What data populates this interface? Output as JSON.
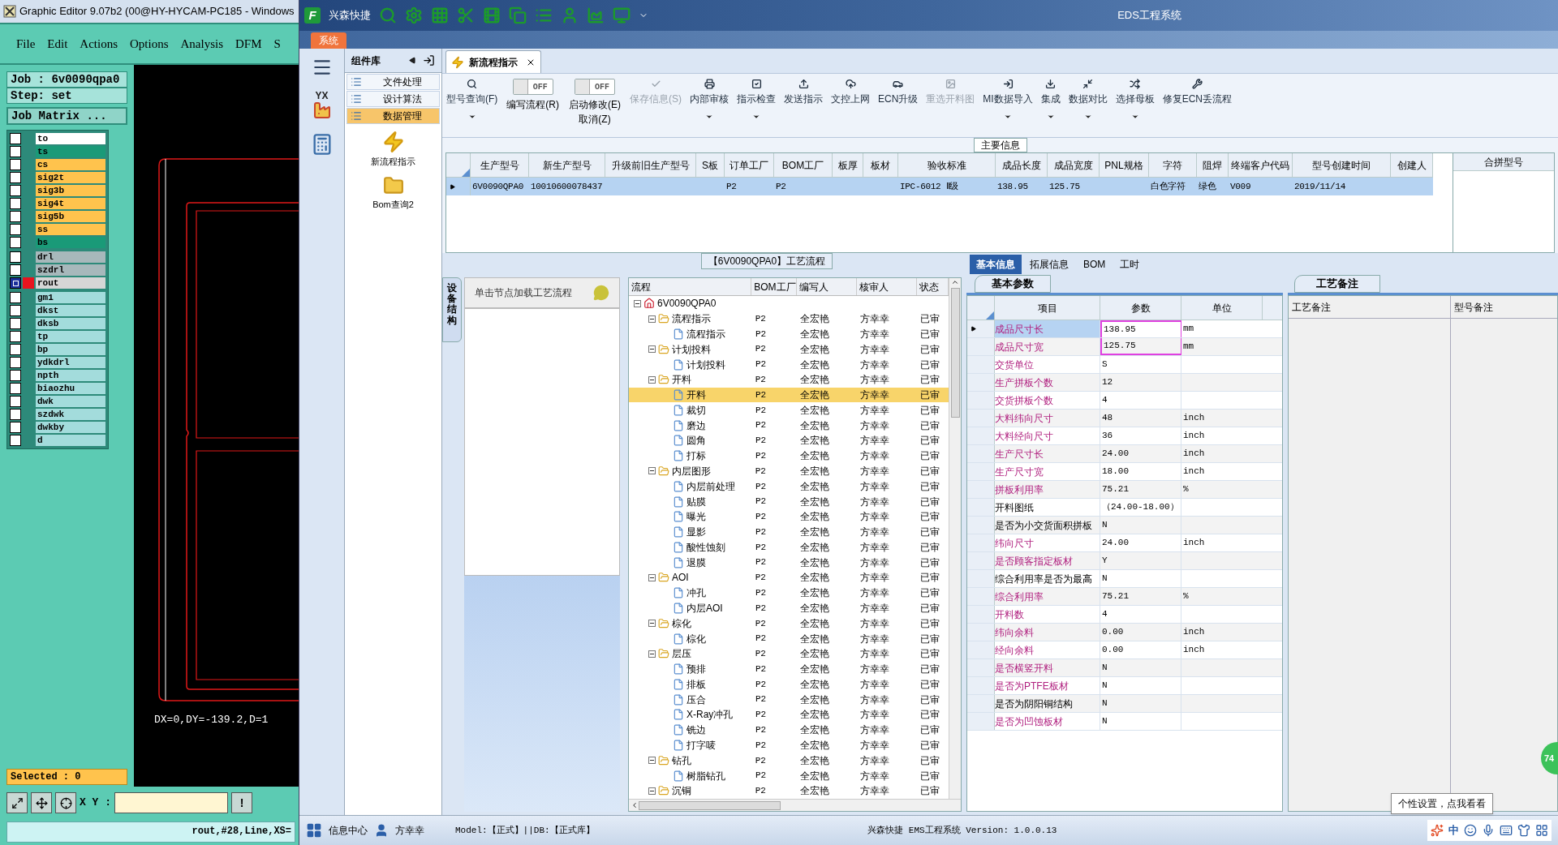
{
  "editor_window": {
    "title": "Graphic Editor 9.07b2 (00@HY-HYCAM-PC185 - Windows",
    "menu": [
      "File",
      "Edit",
      "Actions",
      "Options",
      "Analysis",
      "DFM",
      "S"
    ],
    "job": "Job : 6v0090qpa0",
    "step": "Step: set",
    "job_matrix": "Job Matrix ...",
    "layer_groups": [
      {
        "layers": [
          {
            "name": "to",
            "color": "#ffffff",
            "selected": false
          },
          {
            "name": "ts",
            "color": "#1a9a78",
            "selected": false
          },
          {
            "name": "cs",
            "color": "#ffc34d",
            "selected": false
          },
          {
            "name": "sig2t",
            "color": "#ffc34d",
            "selected": false
          },
          {
            "name": "sig3b",
            "color": "#ffc34d",
            "selected": false
          },
          {
            "name": "sig4t",
            "color": "#ffc34d",
            "selected": false
          },
          {
            "name": "sig5b",
            "color": "#ffc34d",
            "selected": false
          },
          {
            "name": "ss",
            "color": "#ffc34d",
            "selected": false
          },
          {
            "name": "bs",
            "color": "#1a9a78",
            "selected": false
          }
        ]
      },
      {
        "layers": [
          {
            "name": "drl",
            "color": "#a7b8bb",
            "selected": false
          },
          {
            "name": "szdrl",
            "color": "#a7b8bb",
            "selected": false
          },
          {
            "name": "rout",
            "color": "#d6d6d6",
            "selected": true
          }
        ]
      },
      {
        "layers": [
          {
            "name": "gm1",
            "color": "#a3dcdc",
            "selected": false
          },
          {
            "name": "dkst",
            "color": "#a3dcdc",
            "selected": false
          },
          {
            "name": "dksb",
            "color": "#a3dcdc",
            "selected": false
          },
          {
            "name": "tp",
            "color": "#a3dcdc",
            "selected": false
          },
          {
            "name": "bp",
            "color": "#a3dcdc",
            "selected": false
          },
          {
            "name": "ydkdrl",
            "color": "#a3dcdc",
            "selected": false
          },
          {
            "name": "npth",
            "color": "#a3dcdc",
            "selected": false
          },
          {
            "name": "biaozhu",
            "color": "#a3dcdc",
            "selected": false
          },
          {
            "name": "dwk",
            "color": "#a3dcdc",
            "selected": false
          },
          {
            "name": "szdwk",
            "color": "#a3dcdc",
            "selected": false
          },
          {
            "name": "dwkby",
            "color": "#a3dcdc",
            "selected": false
          },
          {
            "name": "d",
            "color": "#a3dcdc",
            "selected": false
          }
        ]
      }
    ],
    "readout": "DX=0,DY=-139.2,D=1",
    "selected_count": "Selected : 0",
    "xy_label": "X Y :",
    "warn_button": "!",
    "status": "rout,#28,Line,XS="
  },
  "app_window": {
    "logo": "F",
    "app_name": "兴森快捷",
    "title": "EDS工程系统",
    "system_tab": "系统",
    "nav_badge": "YX",
    "component_panel": {
      "title": "组件库",
      "items": [
        {
          "label": "文件处理",
          "selected": false
        },
        {
          "label": "设计算法",
          "selected": false
        },
        {
          "label": "数据管理",
          "selected": true
        }
      ],
      "launchers": [
        "新流程指示",
        "Bom查询2"
      ]
    },
    "doc_tab": "新流程指示",
    "toolbar": [
      {
        "kind": "button",
        "label": "型号查询(F)",
        "disabled": false,
        "dropdown": true
      },
      {
        "kind": "toggle",
        "state_text": "OFF",
        "on": false,
        "label": "编写流程(R)"
      },
      {
        "kind": "toggle",
        "state_text": "OFF",
        "on": false,
        "label": "启动修改(E)",
        "label2": "取消(Z)"
      },
      {
        "kind": "button",
        "label": "保存信息(S)",
        "disabled": true,
        "dropdown": false
      },
      {
        "kind": "button",
        "label": "内部审核",
        "disabled": false,
        "dropdown": true
      },
      {
        "kind": "button",
        "label": "指示检查",
        "disabled": false,
        "dropdown": true
      },
      {
        "kind": "button",
        "label": "发送指示",
        "disabled": false,
        "dropdown": false
      },
      {
        "kind": "button",
        "label": "文控上网",
        "disabled": false,
        "dropdown": false
      },
      {
        "kind": "button",
        "label": "ECN升级",
        "disabled": false,
        "dropdown": false
      },
      {
        "kind": "button",
        "label": "重选开料图",
        "disabled": true,
        "dropdown": false
      },
      {
        "kind": "button",
        "label": "MI数据导入",
        "disabled": false,
        "dropdown": true
      },
      {
        "kind": "button",
        "label": "集成",
        "disabled": false,
        "dropdown": true
      },
      {
        "kind": "button",
        "label": "数据对比",
        "disabled": false,
        "dropdown": true
      },
      {
        "kind": "button",
        "label": "选择母板",
        "disabled": false,
        "dropdown": true
      },
      {
        "kind": "button",
        "label": "修复ECN丢流程",
        "disabled": false,
        "dropdown": false
      }
    ],
    "main_info": {
      "title": "主要信息",
      "columns": [
        "生产型号",
        "新生产型号",
        "升级前旧生产型号",
        "S板",
        "订单工厂",
        "BOM工厂",
        "板厚",
        "板材",
        "验收标准",
        "成品长度",
        "成品宽度",
        "PNL规格",
        "字符",
        "阻焊",
        "终端客户代码",
        "型号创建时间",
        "创建人"
      ],
      "rows": [
        {
          "selected": true,
          "cells": [
            "6V0090QPA0",
            "10010600078437",
            null,
            null,
            "P2",
            "P2",
            null,
            null,
            "IPC-6012 Ⅱ级",
            "138.95",
            "125.75",
            null,
            "白色字符",
            "绿色",
            "V009",
            "2019/11/14",
            null
          ]
        }
      ],
      "side_column": "合拼型号"
    },
    "process": {
      "title": "【6V0090QPA0】工艺流程",
      "side_tab": "设备结构",
      "hint": "单击节点加载工艺流程",
      "columns": [
        "流程",
        "BOM工厂",
        "编写人",
        "核审人",
        "状态"
      ],
      "tree": {
        "kind": "root",
        "label": "6V0090QPA0",
        "expanded": true,
        "selected": false,
        "children": [
          {
            "kind": "folder",
            "label": "流程指示",
            "factory": "P2",
            "writer": "全宏艳",
            "reviewer": "方幸幸",
            "status": "已审",
            "expanded": true,
            "selected": false,
            "children": [
              {
                "kind": "doc",
                "label": "流程指示",
                "factory": "P2",
                "writer": "全宏艳",
                "reviewer": "方幸幸",
                "status": "已审",
                "selected": false
              }
            ]
          },
          {
            "kind": "folder",
            "label": "计划投料",
            "factory": "P2",
            "writer": "全宏艳",
            "reviewer": "方幸幸",
            "status": "已审",
            "expanded": true,
            "selected": false,
            "children": [
              {
                "kind": "doc",
                "label": "计划投料",
                "factory": "P2",
                "writer": "全宏艳",
                "reviewer": "方幸幸",
                "status": "已审",
                "selected": false
              }
            ]
          },
          {
            "kind": "folder",
            "label": "开料",
            "factory": "P2",
            "writer": "全宏艳",
            "reviewer": "方幸幸",
            "status": "已审",
            "expanded": true,
            "selected": false,
            "children": [
              {
                "kind": "doc",
                "label": "开料",
                "factory": "P2",
                "writer": "全宏艳",
                "reviewer": "方幸幸",
                "status": "已审",
                "selected": true
              },
              {
                "kind": "doc",
                "label": "裁切",
                "factory": "P2",
                "writer": "全宏艳",
                "reviewer": "方幸幸",
                "status": "已审",
                "selected": false
              },
              {
                "kind": "doc",
                "label": "磨边",
                "factory": "P2",
                "writer": "全宏艳",
                "reviewer": "方幸幸",
                "status": "已审",
                "selected": false
              },
              {
                "kind": "doc",
                "label": "圆角",
                "factory": "P2",
                "writer": "全宏艳",
                "reviewer": "方幸幸",
                "status": "已审",
                "selected": false
              },
              {
                "kind": "doc",
                "label": "打标",
                "factory": "P2",
                "writer": "全宏艳",
                "reviewer": "方幸幸",
                "status": "已审",
                "selected": false
              }
            ]
          },
          {
            "kind": "folder",
            "label": "内层图形",
            "factory": "P2",
            "writer": "全宏艳",
            "reviewer": "方幸幸",
            "status": "已审",
            "expanded": true,
            "selected": false,
            "children": [
              {
                "kind": "doc",
                "label": "内层前处理",
                "factory": "P2",
                "writer": "全宏艳",
                "reviewer": "方幸幸",
                "status": "已审",
                "selected": false
              },
              {
                "kind": "doc",
                "label": "贴膜",
                "factory": "P2",
                "writer": "全宏艳",
                "reviewer": "方幸幸",
                "status": "已审",
                "selected": false
              },
              {
                "kind": "doc",
                "label": "曝光",
                "factory": "P2",
                "writer": "全宏艳",
                "reviewer": "方幸幸",
                "status": "已审",
                "selected": false
              },
              {
                "kind": "doc",
                "label": "显影",
                "factory": "P2",
                "writer": "全宏艳",
                "reviewer": "方幸幸",
                "status": "已审",
                "selected": false
              },
              {
                "kind": "doc",
                "label": "酸性蚀刻",
                "factory": "P2",
                "writer": "全宏艳",
                "reviewer": "方幸幸",
                "status": "已审",
                "selected": false
              },
              {
                "kind": "doc",
                "label": "退膜",
                "factory": "P2",
                "writer": "全宏艳",
                "reviewer": "方幸幸",
                "status": "已审",
                "selected": false
              }
            ]
          },
          {
            "kind": "folder",
            "label": "AOI",
            "factory": "P2",
            "writer": "全宏艳",
            "reviewer": "方幸幸",
            "status": "已审",
            "expanded": true,
            "selected": false,
            "children": [
              {
                "kind": "doc",
                "label": "冲孔",
                "factory": "P2",
                "writer": "全宏艳",
                "reviewer": "方幸幸",
                "status": "已审",
                "selected": false
              },
              {
                "kind": "doc",
                "label": "内层AOI",
                "factory": "P2",
                "writer": "全宏艳",
                "reviewer": "方幸幸",
                "status": "已审",
                "selected": false
              }
            ]
          },
          {
            "kind": "folder",
            "label": "棕化",
            "factory": "P2",
            "writer": "全宏艳",
            "reviewer": "方幸幸",
            "status": "已审",
            "expanded": true,
            "selected": false,
            "children": [
              {
                "kind": "doc",
                "label": "棕化",
                "factory": "P2",
                "writer": "全宏艳",
                "reviewer": "方幸幸",
                "status": "已审",
                "selected": false
              }
            ]
          },
          {
            "kind": "folder",
            "label": "层压",
            "factory": "P2",
            "writer": "全宏艳",
            "reviewer": "方幸幸",
            "status": "已审",
            "expanded": true,
            "selected": false,
            "children": [
              {
                "kind": "doc",
                "label": "预排",
                "factory": "P2",
                "writer": "全宏艳",
                "reviewer": "方幸幸",
                "status": "已审",
                "selected": false
              },
              {
                "kind": "doc",
                "label": "排板",
                "factory": "P2",
                "writer": "全宏艳",
                "reviewer": "方幸幸",
                "status": "已审",
                "selected": false
              },
              {
                "kind": "doc",
                "label": "压合",
                "factory": "P2",
                "writer": "全宏艳",
                "reviewer": "方幸幸",
                "status": "已审",
                "selected": false
              },
              {
                "kind": "doc",
                "label": "X-Ray冲孔",
                "factory": "P2",
                "writer": "全宏艳",
                "reviewer": "方幸幸",
                "status": "已审",
                "selected": false
              },
              {
                "kind": "doc",
                "label": "铣边",
                "factory": "P2",
                "writer": "全宏艳",
                "reviewer": "方幸幸",
                "status": "已审",
                "selected": false
              },
              {
                "kind": "doc",
                "label": "打字唛",
                "factory": "P2",
                "writer": "全宏艳",
                "reviewer": "方幸幸",
                "status": "已审",
                "selected": false
              }
            ]
          },
          {
            "kind": "folder",
            "label": "钻孔",
            "factory": "P2",
            "writer": "全宏艳",
            "reviewer": "方幸幸",
            "status": "已审",
            "expanded": true,
            "selected": false,
            "children": [
              {
                "kind": "doc",
                "label": "树脂钻孔",
                "factory": "P2",
                "writer": "全宏艳",
                "reviewer": "方幸幸",
                "status": "已审",
                "selected": false
              }
            ]
          },
          {
            "kind": "folder",
            "label": "沉铜",
            "factory": "P2",
            "writer": "全宏艳",
            "reviewer": "方幸幸",
            "status": "已审",
            "expanded": true,
            "selected": false
          }
        ]
      }
    },
    "params": {
      "tabs": [
        {
          "label": "基本信息",
          "selected": true
        },
        {
          "label": "拓展信息",
          "selected": false
        },
        {
          "label": "BOM",
          "selected": false
        },
        {
          "label": "工时",
          "selected": false
        }
      ],
      "sub_tab": "基本参数",
      "columns": [
        "项目",
        "参数",
        "单位"
      ],
      "rows": [
        {
          "name": "成品尺寸长",
          "value": "138.95",
          "unit": "mm",
          "flagged": true,
          "selected": true,
          "boxed": true
        },
        {
          "name": "成品尺寸宽",
          "value": "125.75",
          "unit": "mm",
          "flagged": true,
          "selected": false,
          "boxed": true
        },
        {
          "name": "交货单位",
          "value": "S",
          "flagged": true,
          "selected": false,
          "boxed": false
        },
        {
          "name": "生产拼板个数",
          "value": "12",
          "flagged": true,
          "selected": false,
          "boxed": false
        },
        {
          "name": "交货拼板个数",
          "value": "4",
          "flagged": true,
          "selected": false,
          "boxed": false
        },
        {
          "name": "大料纬向尺寸",
          "value": "48",
          "unit": "inch",
          "flagged": true,
          "selected": false,
          "boxed": false
        },
        {
          "name": "大料经向尺寸",
          "value": "36",
          "unit": "inch",
          "flagged": true,
          "selected": false,
          "boxed": false
        },
        {
          "name": "生产尺寸长",
          "value": "24.00",
          "unit": "inch",
          "flagged": true,
          "selected": false,
          "boxed": false
        },
        {
          "name": "生产尺寸宽",
          "value": "18.00",
          "unit": "inch",
          "flagged": true,
          "selected": false,
          "boxed": false
        },
        {
          "name": "拼板利用率",
          "value": "75.21",
          "unit": "%",
          "flagged": true,
          "selected": false,
          "boxed": false
        },
        {
          "name": "开料图纸",
          "value": "（24.00-18.00）",
          "flagged": false,
          "selected": false,
          "boxed": false
        },
        {
          "name": "是否为小交货面积拼板",
          "value": "N",
          "flagged": false,
          "selected": false,
          "boxed": false
        },
        {
          "name": "纬向尺寸",
          "value": "24.00",
          "unit": "inch",
          "flagged": true,
          "selected": false,
          "boxed": false
        },
        {
          "name": "是否顾客指定板材",
          "value": "Y",
          "flagged": true,
          "selected": false,
          "boxed": false
        },
        {
          "name": "综合利用率是否为最高",
          "value": "N",
          "flagged": false,
          "selected": false,
          "boxed": false
        },
        {
          "name": "综合利用率",
          "value": "75.21",
          "unit": "%",
          "flagged": true,
          "selected": false,
          "boxed": false
        },
        {
          "name": "开料数",
          "value": "4",
          "flagged": true,
          "selected": false,
          "boxed": false
        },
        {
          "name": "纬向余料",
          "value": "0.00",
          "unit": "inch",
          "flagged": true,
          "selected": false,
          "boxed": false
        },
        {
          "name": "经向余料",
          "value": "0.00",
          "unit": "inch",
          "flagged": true,
          "selected": false,
          "boxed": false
        },
        {
          "name": "是否横竖开料",
          "value": "N",
          "flagged": true,
          "selected": false,
          "boxed": false
        },
        {
          "name": "是否为PTFE板材",
          "value": "N",
          "flagged": true,
          "selected": false,
          "boxed": false
        },
        {
          "name": "是否为阴阳铜结构",
          "value": "N",
          "flagged": false,
          "selected": false,
          "boxed": false
        },
        {
          "name": "是否为凹蚀板材",
          "value": "N",
          "flagged": true,
          "selected": false,
          "boxed": false
        }
      ]
    },
    "notes": {
      "tab": "工艺备注",
      "columns": [
        "工艺备注",
        "型号备注"
      ]
    },
    "status_bar": {
      "info_center": "信息中心",
      "user": "方幸幸",
      "db": "Model:【正式】||DB:【正式库】",
      "version": "兴森快捷 EMS工程系统 Version: 1.0.0.13",
      "ime": "中"
    },
    "tooltip": "个性设置，点我看看",
    "floating_ball": "74"
  }
}
